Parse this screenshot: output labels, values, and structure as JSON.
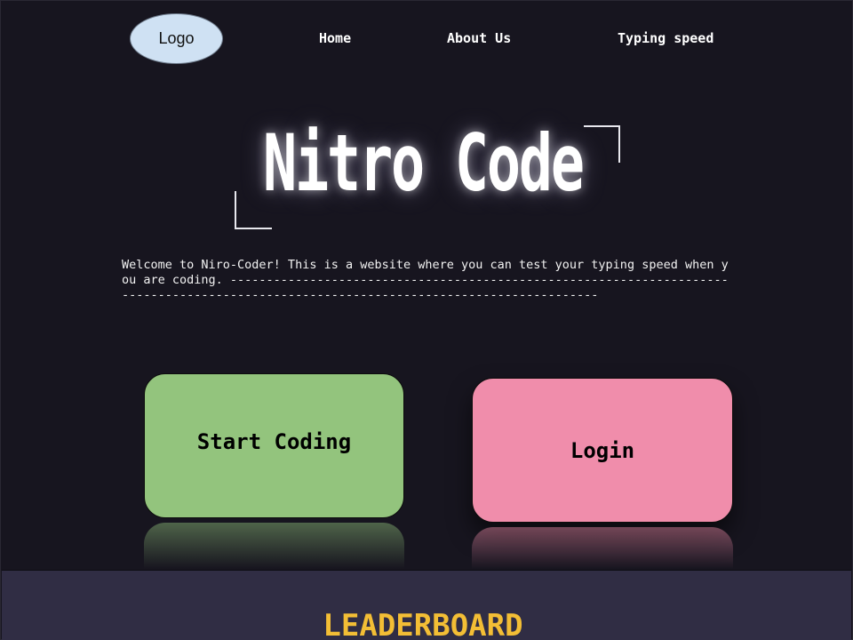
{
  "nav": {
    "logo_label": "Logo",
    "links": [
      "Home",
      "About Us",
      "Typing speed"
    ]
  },
  "hero": {
    "title": "Nitro Code",
    "intro": "Welcome to Niro-Coder! This is a website where you can test your typing speed when you are coding. ---------------------------------------------------------------------------------------------------------------------------------------"
  },
  "buttons": {
    "start_label": "Start Coding",
    "login_label": "Login"
  },
  "leaderboard": {
    "title": "LEADERBOARD"
  },
  "colors": {
    "background": "#17151f",
    "start_button": "#93c47d",
    "login_button": "#f08dab",
    "leaderboard_panel": "#302d44",
    "leaderboard_title": "#f3be35",
    "logo": "#cfe1f3"
  }
}
